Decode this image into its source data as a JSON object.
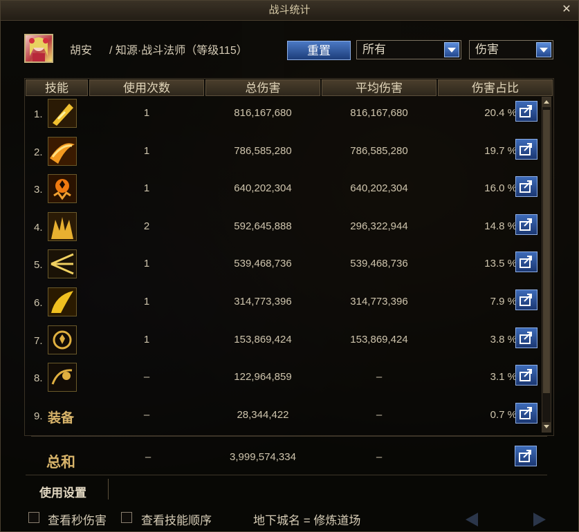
{
  "window": {
    "title": "战斗统计"
  },
  "character": {
    "name": "胡安",
    "description": "/ 知源·战斗法师（等级115）"
  },
  "controls": {
    "reset_label": "重置",
    "filter_selected": "所有",
    "metric_selected": "伤害"
  },
  "table": {
    "headers": [
      "技能",
      "使用次数",
      "总伤害",
      "平均伤害",
      "伤害占比"
    ],
    "rows": [
      {
        "rank": "1.",
        "icon": "skill-1-icon",
        "uses": "1",
        "total": "816,167,680",
        "avg": "816,167,680",
        "pct": "20.4 %"
      },
      {
        "rank": "2.",
        "icon": "skill-2-icon",
        "uses": "1",
        "total": "786,585,280",
        "avg": "786,585,280",
        "pct": "19.7 %"
      },
      {
        "rank": "3.",
        "icon": "skill-3-icon",
        "uses": "1",
        "total": "640,202,304",
        "avg": "640,202,304",
        "pct": "16.0 %"
      },
      {
        "rank": "4.",
        "icon": "skill-4-icon",
        "uses": "2",
        "total": "592,645,888",
        "avg": "296,322,944",
        "pct": "14.8 %"
      },
      {
        "rank": "5.",
        "icon": "skill-5-icon",
        "uses": "1",
        "total": "539,468,736",
        "avg": "539,468,736",
        "pct": "13.5 %"
      },
      {
        "rank": "6.",
        "icon": "skill-6-icon",
        "uses": "1",
        "total": "314,773,396",
        "avg": "314,773,396",
        "pct": "7.9 %"
      },
      {
        "rank": "7.",
        "icon": "skill-7-icon",
        "uses": "1",
        "total": "153,869,424",
        "avg": "153,869,424",
        "pct": "3.8 %"
      },
      {
        "rank": "8.",
        "icon": "skill-8-icon",
        "uses": "–",
        "total": "122,964,859",
        "avg": "–",
        "pct": "3.1 %"
      },
      {
        "rank": "9.",
        "label": "装备",
        "uses": "–",
        "total": "28,344,422",
        "avg": "–",
        "pct": "0.7 %"
      }
    ],
    "total": {
      "label": "总和",
      "uses": "–",
      "total": "3,999,574,334",
      "avg": "–"
    }
  },
  "footer": {
    "settings_tab": "使用设置",
    "checkbox_1": "查看秒伤害",
    "checkbox_2": "查看技能顺序",
    "dungeon": "地下城名 = 修炼道场"
  },
  "colors": {
    "accent_gold": "#d8b46a",
    "button_blue": "#3d6bb8"
  }
}
